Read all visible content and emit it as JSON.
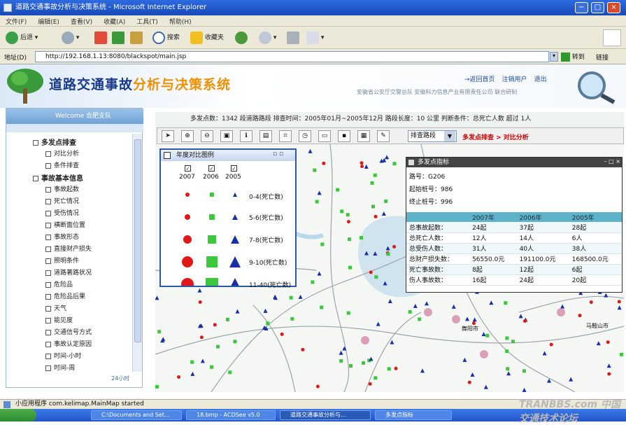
{
  "window": {
    "title": "道路交通事故分析与决策系统 - Microsoft Internet Explorer",
    "controls": [
      "−",
      "□",
      "×"
    ]
  },
  "menu": [
    "文件(F)",
    "编辑(E)",
    "查看(V)",
    "收藏(A)",
    "工具(T)",
    "帮助(H)"
  ],
  "toolbar": {
    "back": "后退",
    "search": "搜索",
    "favorites": "收藏夹"
  },
  "address": {
    "label": "地址(D)",
    "url": "http://192.168.1.13:8080/blackspot/main.jsp",
    "go": "转到",
    "links": "链接"
  },
  "header": {
    "title_main": "道路交通事故",
    "title_accent": "分析与决策系统",
    "links": [
      "→返回首页",
      "注销用户",
      "退出"
    ],
    "org": "安徽省公安厅交警总队  安徽科力信息产业有限责任公司  联合研制"
  },
  "sidebar": {
    "welcome": "Welcome  合肥支队",
    "items": [
      {
        "label": "多发点排查",
        "level": 0
      },
      {
        "label": "对比分析",
        "level": 1
      },
      {
        "label": "条件排查",
        "level": 1
      },
      {
        "label": "事故基本信息",
        "level": 0
      },
      {
        "label": "事故起数",
        "level": 1
      },
      {
        "label": "死亡情况",
        "level": 1
      },
      {
        "label": "受伤情况",
        "level": 1
      },
      {
        "label": "横断面位置",
        "level": 1
      },
      {
        "label": "事故形态",
        "level": 1
      },
      {
        "label": "直接财产损失",
        "level": 1
      },
      {
        "label": "照明条件",
        "level": 1
      },
      {
        "label": "道路著路状况",
        "level": 1
      },
      {
        "label": "危险品",
        "level": 1
      },
      {
        "label": "危险品后果",
        "level": 1
      },
      {
        "label": "天气",
        "level": 1
      },
      {
        "label": "能见度",
        "level": 1
      },
      {
        "label": "交通信号方式",
        "level": 1
      },
      {
        "label": "事故认定原因",
        "level": 1
      },
      {
        "label": "时间-小时",
        "level": 1
      },
      {
        "label": "时间-周",
        "level": 1
      }
    ],
    "footer": "24小时"
  },
  "map": {
    "status": "多发点数：1342  段道路路段  排查时间：2005年01月~2005年12月  路段长度：10 公里  判断条件：总死亡人数  超过  1人",
    "route_select": "排查路段",
    "links": "多发点排查 > 对比分析",
    "place_labels": [
      "舞阳市",
      "马鞍山市"
    ],
    "tools": [
      "pointer-icon",
      "zoom-in-icon",
      "zoom-out-icon",
      "full-extent-icon",
      "info-icon",
      "layer-icon",
      "measure-icon",
      "query-icon",
      "open-icon",
      "save-icon",
      "print-icon",
      "export-icon"
    ]
  },
  "legend": {
    "title": "年度对比图例",
    "years": [
      "2007",
      "2006",
      "2005"
    ],
    "ranges": [
      "0-4(死亡数)",
      "5-6(死亡数)",
      "7-8(死亡数)",
      "9-10(死亡数)",
      "11-40(死亡数)"
    ],
    "colors": {
      "y2007": "#e01818",
      "y2006": "#3cc83c",
      "y2005": "#1a2ea8"
    }
  },
  "info": {
    "title": "多发点指标",
    "road_no_label": "路号：",
    "road_no": "G206",
    "start_label": "起始桩号：",
    "start": "986",
    "end_label": "终止桩号：",
    "end": "996",
    "columns": [
      "",
      "2007年",
      "2006年",
      "2005年"
    ],
    "rows": [
      [
        "总事故起数：",
        "24起",
        "37起",
        "28起"
      ],
      [
        "总死亡人数：",
        "12人",
        "14人",
        "6人"
      ],
      [
        "总受伤人数：",
        "31人",
        "40人",
        "38人"
      ],
      [
        "总财产损失数：",
        "56550.0元",
        "191100.0元",
        "168500.0元"
      ],
      [
        "死亡事故数：",
        "8起",
        "12起",
        "6起"
      ],
      [
        "伤人事故数：",
        "16起",
        "24起",
        "20起"
      ]
    ]
  },
  "status_bar": "小应用程序 com.kelimap.MainMap started",
  "taskbar": {
    "tasks": [
      "C:\\Documents and Set...",
      "18.bmp - ACDSee v5.0",
      "道路交通事故分析与...",
      "多发点指标"
    ],
    "watermark": "TRANBBS.com 中国交通技术论坛"
  }
}
